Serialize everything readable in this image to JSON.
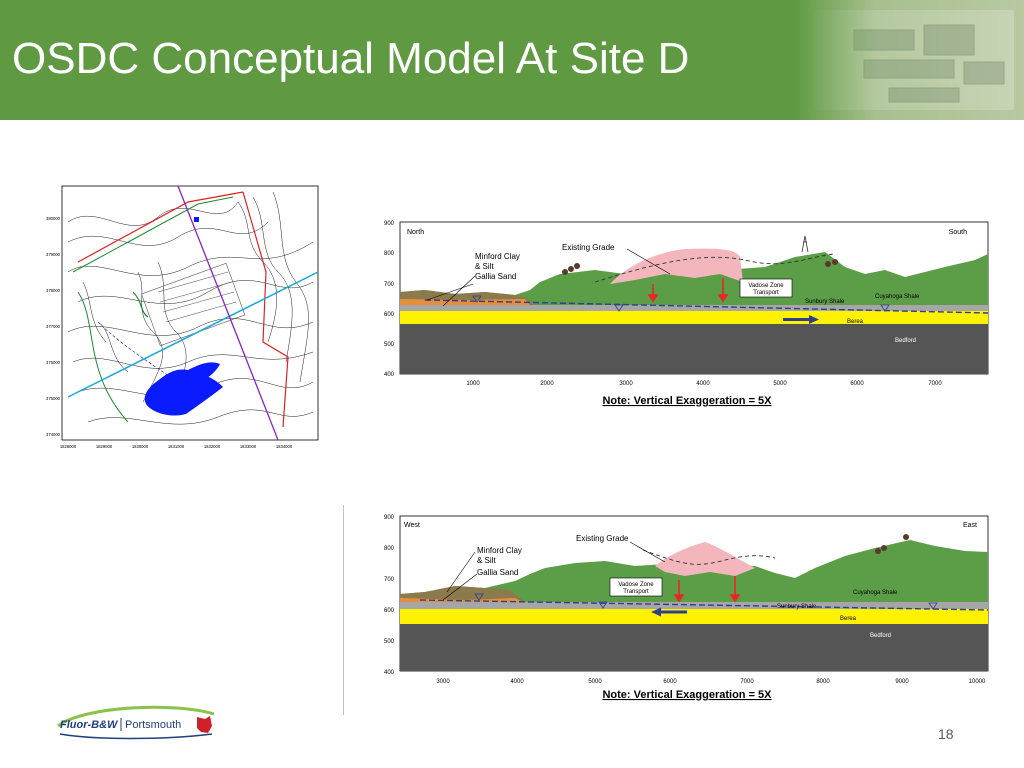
{
  "slide": {
    "title": "OSDC Conceptual Model At Site D",
    "page_number": "18"
  },
  "colors": {
    "header_green": "#5f9a43",
    "hill_green": "#5c9e48",
    "fill_pink": "#f4b6bd",
    "sand_yellow": "#fff200",
    "clay_orange": "#e58e3c",
    "shale_gray": "#a6a6a6",
    "bedrock_dark": "#555555",
    "arrow_red": "#e8262a",
    "arrow_blue": "#2e3f8f"
  },
  "map": {
    "y_ticks": [
      "380000",
      "379000",
      "378000",
      "377000",
      "376000",
      "375000",
      "374000"
    ],
    "x_ticks": [
      "1828000",
      "1829000",
      "1830000",
      "1831000",
      "1832000",
      "1833000",
      "1834000"
    ]
  },
  "section_ns": {
    "y_ticks": [
      "900",
      "800",
      "700",
      "600",
      "500",
      "400"
    ],
    "x_ticks": [
      "1000",
      "2000",
      "3000",
      "4000",
      "5000",
      "6000",
      "7000"
    ],
    "left_dir": "North",
    "right_dir": "South",
    "labels": {
      "existing_grade": "Existing Grade",
      "minford_1": "Minford Clay",
      "minford_2": "& Silt",
      "gallia": "Gallia Sand",
      "vadose_1": "Vadose Zone",
      "vadose_2": "Transport",
      "sunbury": "Sunbury Shale",
      "cuyahoga": "Cuyahoga Shale",
      "berea": "Berea",
      "bedford": "Bedford"
    },
    "note": "Note: Vertical Exaggeration = 5X"
  },
  "section_ew": {
    "y_ticks": [
      "900",
      "800",
      "700",
      "600",
      "500",
      "400"
    ],
    "x_ticks": [
      "3000",
      "4000",
      "5000",
      "6000",
      "7000",
      "8000",
      "9000",
      "10000"
    ],
    "left_dir": "West",
    "right_dir": "East",
    "labels": {
      "existing_grade": "Existing Grade",
      "minford_1": "Minford Clay",
      "minford_2": "& Silt",
      "gallia": "Gallia Sand",
      "vadose_1": "Vadose Zone",
      "vadose_2": "Transport",
      "sunbury": "Sunbury Shale",
      "cuyahoga": "Cuyahoga Shale",
      "berea": "Berea",
      "bedford": "Bedford"
    },
    "note": "Note: Vertical Exaggeration = 5X"
  },
  "logo": {
    "brand": "Fluor-B&W",
    "site": "Portsmouth"
  }
}
